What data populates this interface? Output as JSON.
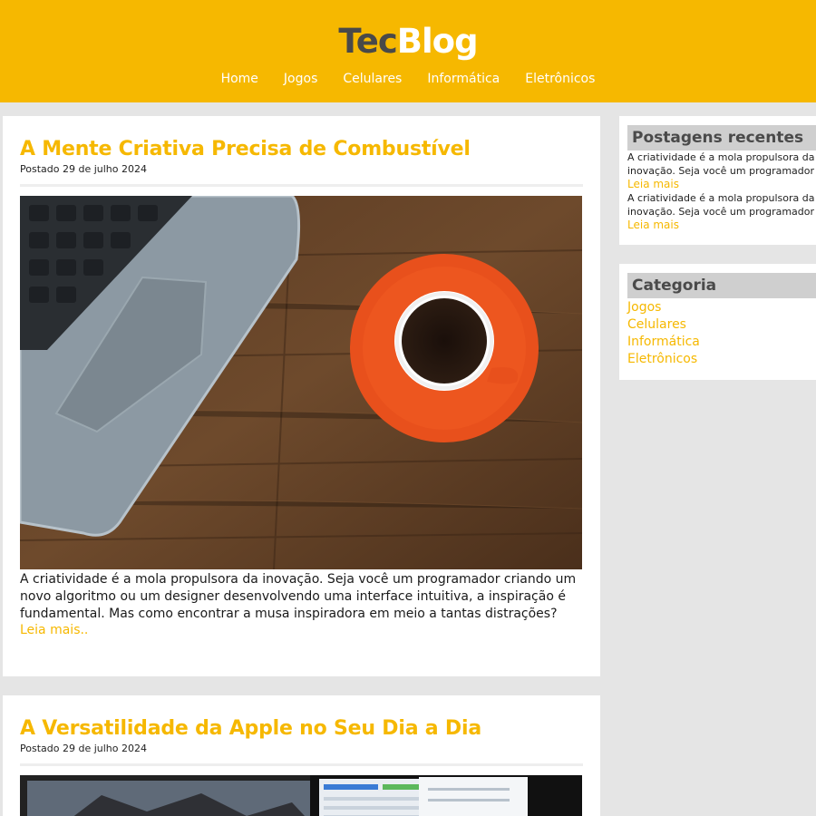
{
  "header": {
    "logo_part1": "Tec",
    "logo_part2": "Blog",
    "nav": [
      "Home",
      "Jogos",
      "Celulares",
      "Informática",
      "Eletrônicos"
    ]
  },
  "posts": [
    {
      "title": "A Mente Criativa Precisa de Combustível",
      "date": "Postado 29 de julho 2024",
      "image": "laptop-and-coffee-cup-on-wooden-table",
      "excerpt": "A criatividade é a mola propulsora da inovação. Seja você um programador criando um novo algoritmo ou um designer desenvolvendo uma interface intuitiva, a inspiração é fundamental. Mas como encontrar a musa inspiradora em meio a tantas distrações?",
      "read_more": "Leia mais.."
    },
    {
      "title": "A Versatilidade da Apple no Seu Dia a Dia",
      "date": "Postado 29 de julho 2024",
      "image": "apple-laptop-screen"
    }
  ],
  "sidebar": {
    "recent": {
      "title": "Postagens recentes",
      "items": [
        {
          "line1": "A criatividade é a mola propulsora da",
          "line2": "inovação. Seja você um programador",
          "more": "Leia mais"
        },
        {
          "line1": "A criatividade é a mola propulsora da",
          "line2": "inovação. Seja você um programador",
          "more": "Leia mais"
        }
      ]
    },
    "categories": {
      "title": "Categoria",
      "items": [
        "Jogos",
        "Celulares",
        "Informática",
        "Eletrônicos"
      ]
    }
  },
  "colors": {
    "accent": "#f6b800",
    "background": "#e5e5e5",
    "logo_dark": "#494949"
  }
}
